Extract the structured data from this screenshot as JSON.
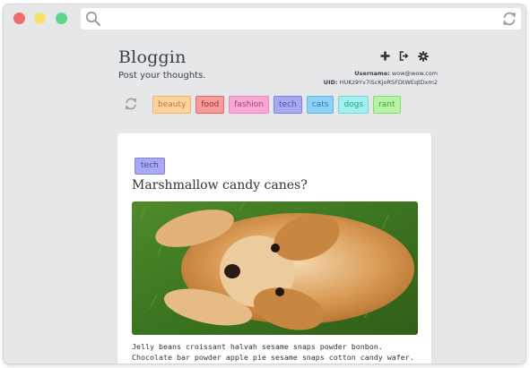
{
  "app": {
    "title": "Bloggin",
    "tagline": "Post your thoughts."
  },
  "account": {
    "username_label": "Username:",
    "username_value": "wow@wow.com",
    "uid_label": "UID:",
    "uid_value": "HUKz9Yv7iScKjoRSFDtWEqtDxm2"
  },
  "header_actions": [
    {
      "name": "add-post-icon",
      "icon": "plus"
    },
    {
      "name": "logout-icon",
      "icon": "sign-out"
    },
    {
      "name": "settings-icon",
      "icon": "gear"
    }
  ],
  "tags": [
    {
      "label": "beauty",
      "bg": "#ffd39e",
      "border": "#f2b36c",
      "color": "#b97a30"
    },
    {
      "label": "food",
      "bg": "#fb9a9a",
      "border": "#e06b6b",
      "color": "#8c3434"
    },
    {
      "label": "fashion",
      "bg": "#f9a7d4",
      "border": "#e785bd",
      "color": "#a5447c"
    },
    {
      "label": "tech",
      "bg": "#a8a8f3",
      "border": "#8080e0",
      "color": "#4b4bb0"
    },
    {
      "label": "cats",
      "bg": "#8fd1f6",
      "border": "#63b6e6",
      "color": "#2f7eb3"
    },
    {
      "label": "dogs",
      "bg": "#a3f1ef",
      "border": "#6fd7d4",
      "color": "#2f9894"
    },
    {
      "label": "rant",
      "bg": "#b5f3a6",
      "border": "#87d974",
      "color": "#4a9a38"
    }
  ],
  "post": {
    "tag": "tech",
    "title": "Marshmallow candy canes?",
    "image_alt": "golden retriever puppy lying on grass looking up",
    "excerpt": "Jelly beans croissant halvah sesame snaps powder bonbon. Chocolate bar powder apple pie sesame snaps cotton candy wafer. Fruitcake ice"
  },
  "colors": {
    "window_bg": "#e6e7e9",
    "text": "#3a3f45",
    "dot_red": "#f26b6c",
    "dot_yellow": "#f6e26a",
    "dot_green": "#5fd588"
  }
}
